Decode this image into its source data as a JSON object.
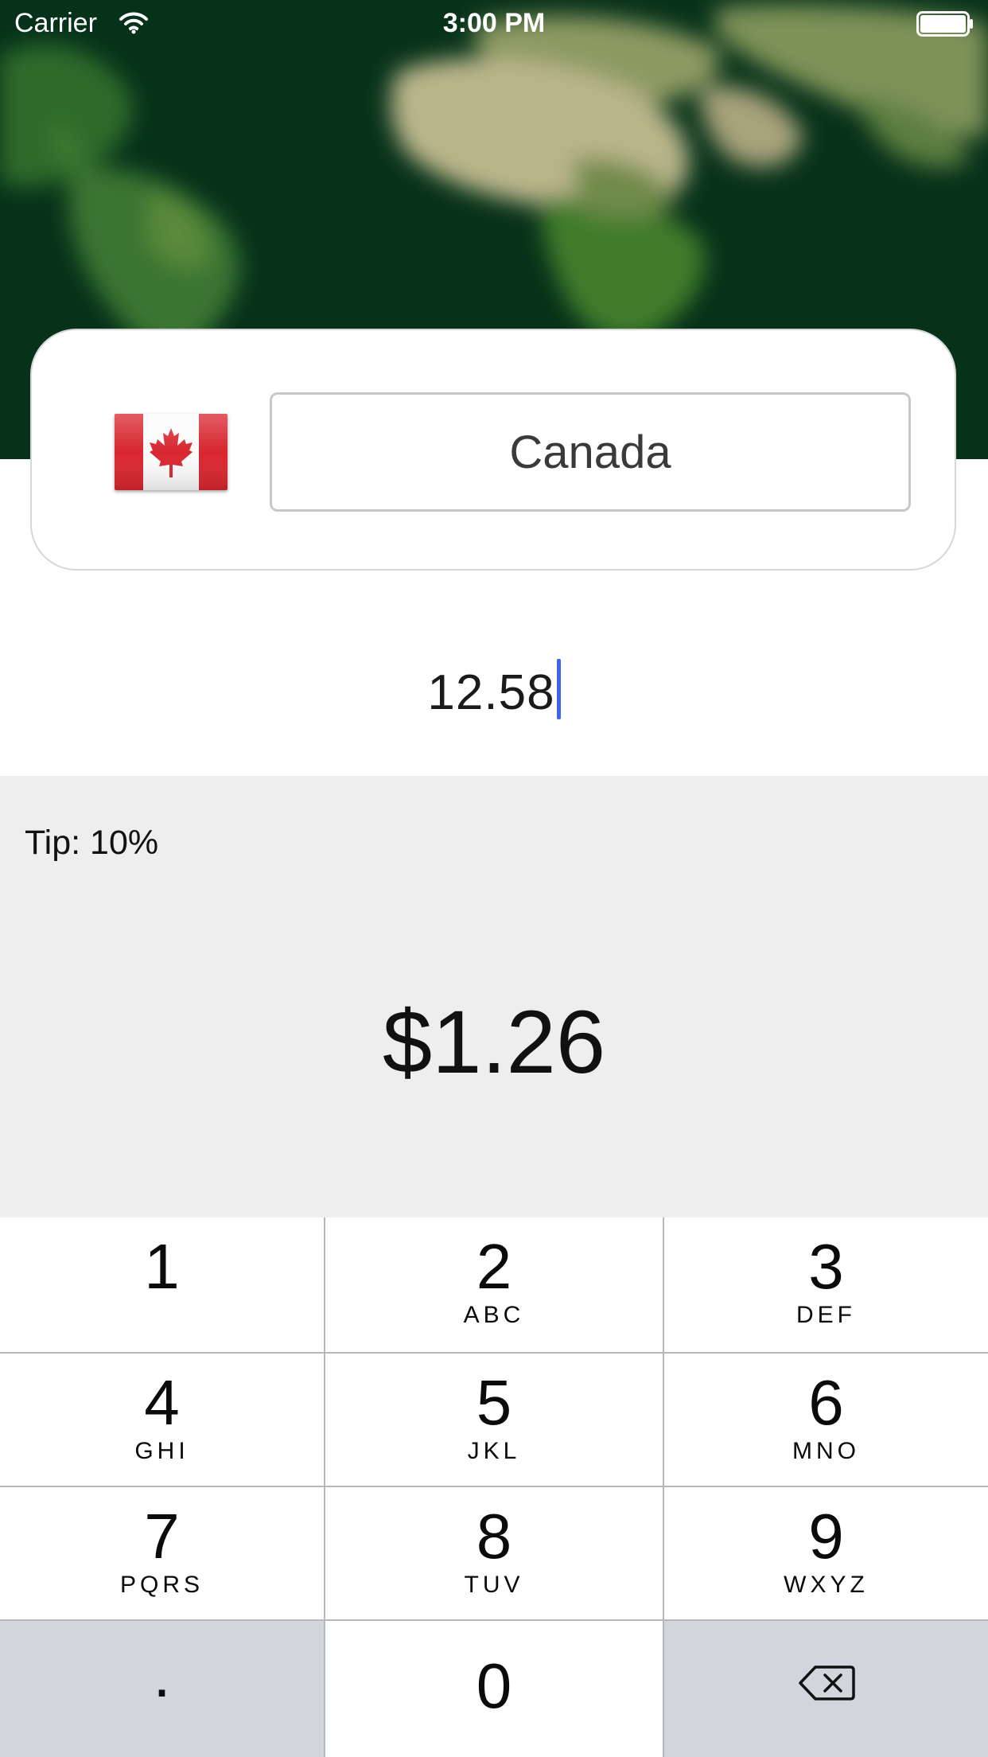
{
  "status_bar": {
    "carrier": "Carrier",
    "time": "3:00 PM",
    "wifi_icon": "wifi-icon",
    "battery_icon": "battery-icon"
  },
  "country_selector": {
    "flag_icon": "canada-flag-icon",
    "country": "Canada"
  },
  "bill": {
    "amount": "12.58"
  },
  "tip": {
    "label": "Tip: 10%",
    "amount": "$1.26"
  },
  "keypad": {
    "keys": [
      {
        "digit": "1",
        "letters": ""
      },
      {
        "digit": "2",
        "letters": "ABC"
      },
      {
        "digit": "3",
        "letters": "DEF"
      },
      {
        "digit": "4",
        "letters": "GHI"
      },
      {
        "digit": "5",
        "letters": "JKL"
      },
      {
        "digit": "6",
        "letters": "MNO"
      },
      {
        "digit": "7",
        "letters": "PQRS"
      },
      {
        "digit": "8",
        "letters": "TUV"
      },
      {
        "digit": "9",
        "letters": "WXYZ"
      }
    ],
    "decimal": ".",
    "zero": "0",
    "delete_icon": "backspace-icon"
  },
  "colors": {
    "map_background": "#07321a",
    "cursor": "#3f63f0",
    "tip_panel": "#eeeeee",
    "keypad_dark_key": "#d2d5db"
  }
}
